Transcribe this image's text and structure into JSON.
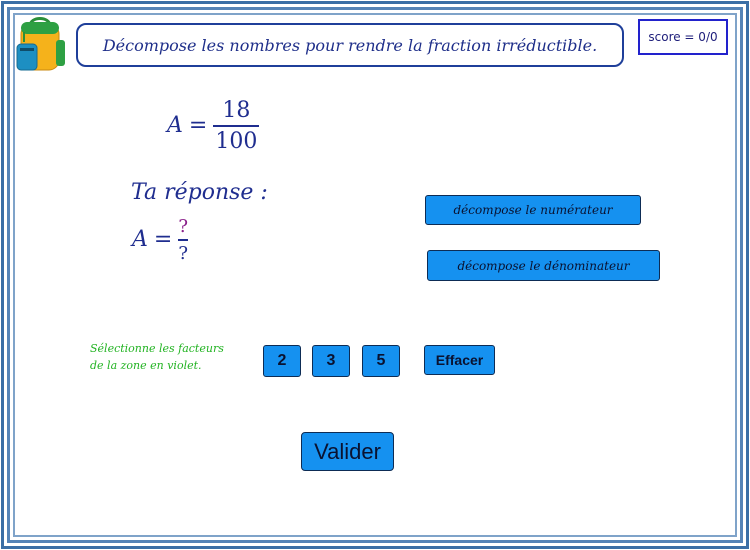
{
  "header": {
    "instruction": "Décompose les nombres pour rendre la fraction irréductible.",
    "score": "score = 0/0"
  },
  "problem": {
    "variable": "A",
    "equals": "=",
    "numerator": "18",
    "denominator": "100"
  },
  "answer": {
    "label": "Ta réponse :",
    "variable": "A",
    "equals": "=",
    "numerator": "?",
    "denominator": "?"
  },
  "actions": {
    "decompose_numerator": "décompose le numérateur",
    "decompose_denominator": "décompose le dénominateur"
  },
  "factors": {
    "hint_line1": "Sélectionne les facteurs",
    "hint_line2": "de la zone en violet.",
    "buttons": [
      "2",
      "3",
      "5"
    ],
    "clear": "Effacer"
  },
  "validate": "Valider",
  "icons": {
    "backpack": "backpack-icon"
  },
  "colors": {
    "button_bg": "#1591f0",
    "text_blue": "#1f2d8f",
    "hint_green": "#22b322",
    "question_purple": "#8a1f8a"
  }
}
